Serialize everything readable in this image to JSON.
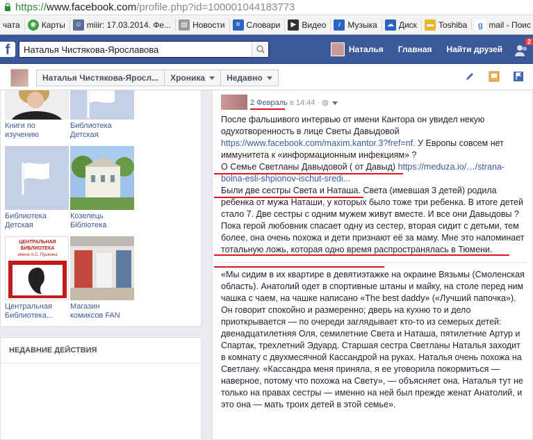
{
  "browser": {
    "url_scheme": "https://",
    "url_host": "www.facebook.com",
    "url_path": "/profile.php?id=100001044183773"
  },
  "bookmarks": [
    {
      "label": "чата",
      "icon": "none",
      "color": "#f3f3f3"
    },
    {
      "label": "Карты",
      "icon": "maps-icon",
      "color": "#3aa142"
    },
    {
      "label": "miiir: 17.03.2014. Фе...",
      "icon": "user-icon",
      "color": "#5b6f9a"
    },
    {
      "label": "Новости",
      "icon": "news-icon",
      "color": "#999999"
    },
    {
      "label": "Словари",
      "icon": "dictionary-icon",
      "color": "#2a65c6"
    },
    {
      "label": "Видео",
      "icon": "video-icon",
      "color": "#333333"
    },
    {
      "label": "Музыка",
      "icon": "music-icon",
      "color": "#2a65c6"
    },
    {
      "label": "Диск",
      "icon": "disk-icon",
      "color": "#2a65c6"
    },
    {
      "label": "Toshiba",
      "icon": "folder-icon",
      "color": "#e8b52e"
    },
    {
      "label": "mail - Поис",
      "icon": "google-icon",
      "color": "#4285f4"
    }
  ],
  "fb": {
    "search_value": "Наталья Чистякова-Ярославова",
    "user_name": "Наталья",
    "home": "Главная",
    "find_friends": "Найти друзей",
    "friend_requests": "2"
  },
  "timeline": {
    "name": "Наталья Чистякова-Яросл...",
    "tab": "Хроника",
    "filter": "Недавно"
  },
  "photos": [
    {
      "caption": "Книги по изучению"
    },
    {
      "caption": "Библиотека Детская"
    },
    {
      "caption": "Библиотека Детская"
    },
    {
      "caption": "Козелець Бібліотека"
    },
    {
      "caption": "Центральная Библиотека..."
    },
    {
      "caption": "Магазин комиксов FAN"
    }
  ],
  "library_sign": {
    "line1": "ЦЕНТРАЛЬНАЯ",
    "line2": "БИБЛИОТЕКА",
    "line3": "имени А.С. Пушкина"
  },
  "recent": {
    "header": "НЕДАВНИЕ ДЕЙСТВИЯ"
  },
  "post": {
    "date": "2 Февраль",
    "time": "в 14:44",
    "p1": "После фальшивого интервью от имени Кантора он увидел некую одухотворенность в лице Светы Давыдовой",
    "link1": "https://www.facebook.com/maxim.kantor.3?fref=nf.",
    "p1b": " У Европы совсем нет иммунитета к «информационным инфекциям» ?",
    "p2a": "О Семье Светланы Давыдовой ( от Давыд) ",
    "link2": "https://meduza.io/…/strana-bolna-esli-shpionov-ischut-sredi...",
    "p3a": "Были две сестры Света и Наташа",
    "p3b": ". Света (имевшая 3 детей) родила ребенка от мужа Наташи, у которых было тоже три ребенка. В итоге детей стало 7. Две сестры с одним мужем живут вместе. И все они Давыдовы ? Пока герой любовник спасает одну из сестер, вторая сидит с детьми, тем более, она очень похожа и дети признают её за маму. Мне это напоминает тотальную ложь, которая одно время распространялась в Тюмени.",
    "quote": "«Мы сидим в их квартире в девятиэтажке на окраине Вязьмы (Смоленская область). Анатолий одет в спортивные штаны и майку, на столе перед ним чашка с чаем, на чашке написано «The best daddy» («Лучший папочка»). Он говорит спокойно и размеренно; дверь на кухню то и дело приоткрывается — по очереди заглядывает кто-то из семерых детей: двенадцатилетняя Оля, семилетние Света и Наташа, пятилетние Артур и Спартак, трехлетний Эдуард. Старшая сестра Светланы Наталья заходит в комнату с двухмесячной Кассандрой на руках. Наталья очень похожа на Светлану. «Кассандра меня приняла, я ее уговорила покормиться — наверное, потому что похожа на Свету», — объясняет она. Наталья тут не только на правах сестры — именно на ней был прежде женат Анатолий, и это она — мать троих детей в этой семье»."
  }
}
